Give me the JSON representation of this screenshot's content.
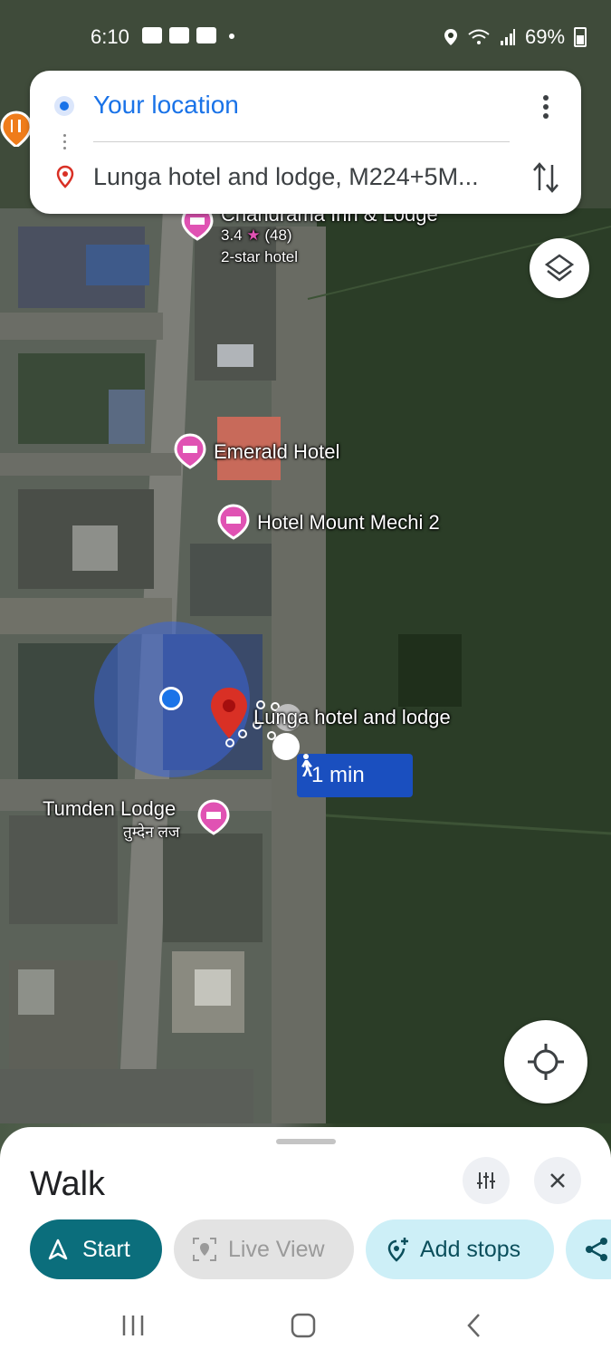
{
  "status_bar": {
    "time": "6:10",
    "battery": "69%"
  },
  "directions": {
    "origin": "Your location",
    "destination": "Lunga hotel and lodge, M224+5M..."
  },
  "map": {
    "places": [
      {
        "name": "Chandrama Inn & Lodge",
        "rating": "3.4",
        "reviews": "(48)",
        "category": "2-star hotel"
      },
      {
        "name": "Emerald Hotel"
      },
      {
        "name": "Hotel Mount Mechi 2"
      },
      {
        "name": "Lunga hotel and lodge"
      },
      {
        "name": "Tumden Lodge",
        "name_local": "तुम्देन लज"
      }
    ],
    "walk_time": "1 min"
  },
  "sheet": {
    "mode": "Walk",
    "start_label": "Start",
    "live_view_label": "Live View",
    "add_stops_label": "Add stops"
  },
  "colors": {
    "accent_blue": "#1a73e8",
    "start_button": "#0b6e7c",
    "destination_pin": "#d93025",
    "hotel_pin": "#e052b3"
  }
}
